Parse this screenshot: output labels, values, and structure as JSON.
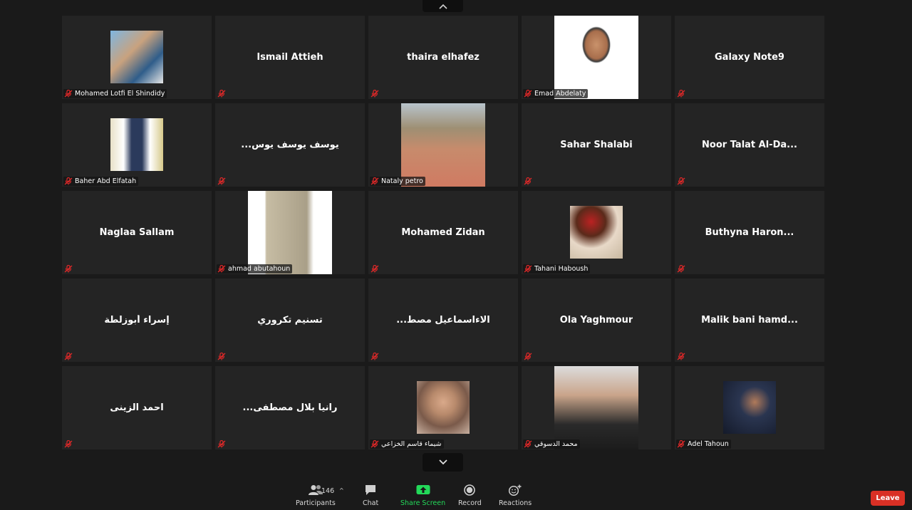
{
  "participants": [
    {
      "name": "Mohamed Lotfi El Shindidy",
      "display": "",
      "media": "avatar"
    },
    {
      "name": "",
      "display": "Ismail Attieh",
      "media": "none"
    },
    {
      "name": "",
      "display": "thaira elhafez",
      "media": "none"
    },
    {
      "name": "Emad Abdelaty",
      "display": "",
      "media": "video"
    },
    {
      "name": "",
      "display": "Galaxy Note9",
      "media": "none"
    },
    {
      "name": "Baher Abd Elfatah",
      "display": "",
      "media": "avatar"
    },
    {
      "name": "",
      "display": "...يوسف يوسف يوس",
      "media": "none"
    },
    {
      "name": "Nataly petro",
      "display": "",
      "media": "video"
    },
    {
      "name": "",
      "display": "Sahar Shalabi",
      "media": "none"
    },
    {
      "name": "",
      "display": "Noor Talat Al-Da...",
      "media": "none"
    },
    {
      "name": "",
      "display": "Naglaa Sallam",
      "media": "none"
    },
    {
      "name": "ahmad abutahoun",
      "display": "",
      "media": "video"
    },
    {
      "name": "",
      "display": "Mohamed Zidan",
      "media": "none"
    },
    {
      "name": "Tahani Haboush",
      "display": "",
      "media": "avatar"
    },
    {
      "name": "",
      "display": "Buthyna Haron...",
      "media": "none"
    },
    {
      "name": "",
      "display": "إسراء أبوزلطة",
      "media": "none"
    },
    {
      "name": "",
      "display": "تسنيم تكروري",
      "media": "none"
    },
    {
      "name": "",
      "display": "...الاءاسماعيل مصط",
      "media": "none"
    },
    {
      "name": "",
      "display": "Ola Yaghmour",
      "media": "none"
    },
    {
      "name": "",
      "display": "Malik bani hamd...",
      "media": "none"
    },
    {
      "name": "",
      "display": "احمد الزينى",
      "media": "none"
    },
    {
      "name": "",
      "display": "...رانيا بلال مصطفى",
      "media": "none"
    },
    {
      "name": "شيماء قاسم الخزاعي",
      "display": "",
      "media": "avatar"
    },
    {
      "name": "محمد الدسوقي",
      "display": "",
      "media": "video"
    },
    {
      "name": "Adel Tahoun",
      "display": "",
      "media": "avatar"
    }
  ],
  "toolbar": {
    "participants_label": "Participants",
    "participants_count": "146",
    "chat_label": "Chat",
    "share_label": "Share Screen",
    "record_label": "Record",
    "reactions_label": "Reactions",
    "leave_label": "Leave"
  },
  "colors": {
    "share_green": "#23d959",
    "leave_red": "#d93025",
    "mic_muted_red": "#e02828"
  }
}
